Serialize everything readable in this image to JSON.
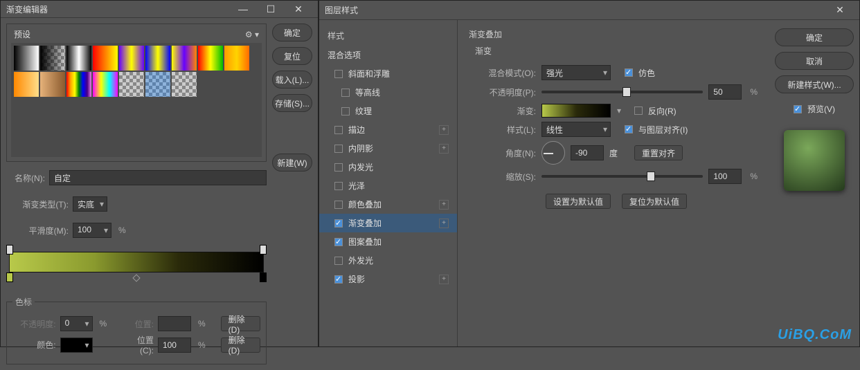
{
  "left": {
    "title": "渐变编辑器",
    "presets_label": "预设",
    "buttons": {
      "ok": "确定",
      "reset": "复位",
      "load": "载入(L)...",
      "save": "存储(S)...",
      "new": "新建(W)"
    },
    "name_label": "名称(N):",
    "name_value": "自定",
    "grad_type_label": "渐变类型(T):",
    "grad_type_value": "实底",
    "smooth_label": "平滑度(M):",
    "smooth_value": "100",
    "stops_title": "色标",
    "opacity_label": "不透明度:",
    "opacity_value": "0",
    "pos_label": "位置:",
    "pos_value": "",
    "delete_label": "删除(D)",
    "color_label": "颜色:",
    "pos2_label": "位置(C):",
    "pos2_value": "100",
    "pct": "%"
  },
  "right": {
    "title": "图层样式",
    "styles_header": "样式",
    "items": [
      {
        "label": "混合选项",
        "check": null,
        "plus": false
      },
      {
        "label": "斜面和浮雕",
        "check": false,
        "plus": false,
        "indent": 1
      },
      {
        "label": "等高线",
        "check": false,
        "plus": false,
        "indent": 2
      },
      {
        "label": "纹理",
        "check": false,
        "plus": false,
        "indent": 2
      },
      {
        "label": "描边",
        "check": false,
        "plus": true,
        "indent": 1
      },
      {
        "label": "内阴影",
        "check": false,
        "plus": true,
        "indent": 1
      },
      {
        "label": "内发光",
        "check": false,
        "plus": false,
        "indent": 1
      },
      {
        "label": "光泽",
        "check": false,
        "plus": false,
        "indent": 1
      },
      {
        "label": "颜色叠加",
        "check": false,
        "plus": true,
        "indent": 1
      },
      {
        "label": "渐变叠加",
        "check": true,
        "plus": true,
        "indent": 1,
        "sel": true
      },
      {
        "label": "图案叠加",
        "check": true,
        "plus": false,
        "indent": 1
      },
      {
        "label": "外发光",
        "check": false,
        "plus": false,
        "indent": 1
      },
      {
        "label": "投影",
        "check": true,
        "plus": true,
        "indent": 1
      }
    ],
    "panel_title": "渐变叠加",
    "group_title": "渐变",
    "blend_label": "混合模式(O):",
    "blend_value": "强光",
    "dither_label": "仿色",
    "opacity_label": "不透明度(P):",
    "opacity_value": "50",
    "grad_label": "渐变:",
    "reverse_label": "反向(R)",
    "style_label": "样式(L):",
    "style_value": "线性",
    "align_label": "与图层对齐(I)",
    "angle_label": "角度(N):",
    "angle_value": "-90",
    "angle_unit": "度",
    "reset_align": "重置对齐",
    "scale_label": "缩放(S):",
    "scale_value": "100",
    "set_default": "设置为默认值",
    "reset_default": "复位为默认值",
    "buttons": {
      "ok": "确定",
      "cancel": "取消",
      "newstyle": "新建样式(W)..."
    },
    "preview_label": "预览(V)",
    "pct": "%"
  },
  "watermark": "UiBQ.CoM"
}
